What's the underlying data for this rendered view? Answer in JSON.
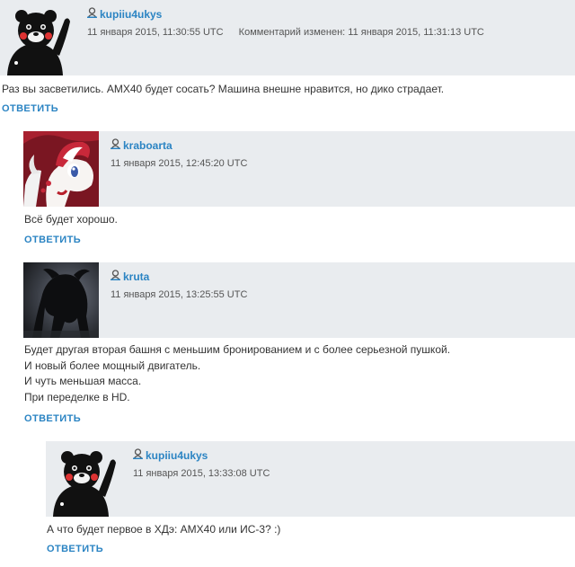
{
  "reply_label": "ОТВЕТИТЬ",
  "comments": [
    {
      "author": "kupiiu4ukys",
      "date": "11 января 2015, 11:30:55 UTC",
      "edited_label": "Комментарий изменен:",
      "edited_date": "11 января 2015, 11:31:13 UTC",
      "lines": [
        "Раз вы засветились. AMX40 будет сосать? Машина внешне нравится, но дико страдает."
      ],
      "avatar": "kumamon-avatar"
    },
    {
      "author": "kraboarta",
      "date": "11 января 2015, 12:45:20 UTC",
      "lines": [
        "Всё будет хорошо."
      ],
      "avatar": "pony-avatar"
    },
    {
      "author": "kruta",
      "date": "11 января 2015, 13:25:55 UTC",
      "lines": [
        "Будет другая вторая башня с меньшим бронированием и с более серьезной пушкой.",
        "И новый более мощный двигатель.",
        "И чуть меньшая масса.",
        "При переделке в HD."
      ],
      "avatar": "dark-creature-avatar"
    },
    {
      "author": "kupiiu4ukys",
      "date": "11 января 2015, 13:33:08 UTC",
      "lines": [
        "А что будет первое в ХДэ: AMX40 или ИС-3? :)"
      ],
      "avatar": "kumamon-avatar"
    }
  ],
  "colors": {
    "link": "#2b84c3",
    "header_bg": "#e9ecef",
    "text": "#333333"
  }
}
